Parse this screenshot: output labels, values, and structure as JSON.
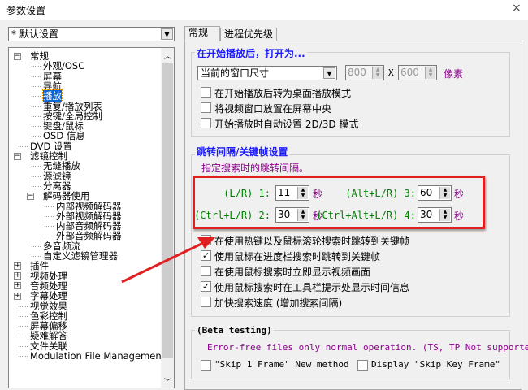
{
  "window": {
    "title": "参数设置",
    "close": "×"
  },
  "profile": {
    "value": "* 默认设置"
  },
  "tree": [
    {
      "label": "常规",
      "level": 0,
      "exp": "−"
    },
    {
      "label": "外观/OSC",
      "level": 1
    },
    {
      "label": "屏幕",
      "level": 1
    },
    {
      "label": "导航",
      "level": 1
    },
    {
      "label": "播放",
      "level": 1,
      "selected": true
    },
    {
      "label": "重复/播放列表",
      "level": 1
    },
    {
      "label": "按键/全局控制",
      "level": 1
    },
    {
      "label": "键盘/鼠标",
      "level": 1
    },
    {
      "label": "OSD 信息",
      "level": 1
    },
    {
      "label": "DVD 设置",
      "level": 0
    },
    {
      "label": "滤镜控制",
      "level": 0,
      "exp": "−"
    },
    {
      "label": "无缝播放",
      "level": 1
    },
    {
      "label": "源滤镜",
      "level": 1
    },
    {
      "label": "分离器",
      "level": 1
    },
    {
      "label": "解码器使用",
      "level": 1,
      "exp": "−"
    },
    {
      "label": "内部视频解码器",
      "level": 2
    },
    {
      "label": "外部视频解码器",
      "level": 2
    },
    {
      "label": "内部音频解码器",
      "level": 2
    },
    {
      "label": "外部音频解码器",
      "level": 2
    },
    {
      "label": "多音频流",
      "level": 1
    },
    {
      "label": "自定义滤镜管理器",
      "level": 1
    },
    {
      "label": "插件",
      "level": 0,
      "exp": "+"
    },
    {
      "label": "视频处理",
      "level": 0,
      "exp": "+"
    },
    {
      "label": "音频处理",
      "level": 0,
      "exp": "+"
    },
    {
      "label": "字幕处理",
      "level": 0,
      "exp": "+"
    },
    {
      "label": "视觉效果",
      "level": 0
    },
    {
      "label": "色彩控制",
      "level": 0
    },
    {
      "label": "屏幕偏移",
      "level": 0
    },
    {
      "label": "疑难解答",
      "level": 0
    },
    {
      "label": "文件关联",
      "level": 0
    },
    {
      "label": "Modulation File Management",
      "level": 0
    }
  ],
  "tabs": [
    {
      "label": "常规"
    },
    {
      "label": "进程优先级"
    }
  ],
  "open": {
    "title": "在开始播放后，打开为...",
    "size_mode": "当前的窗口尺寸",
    "width": "800",
    "x": "X",
    "height": "600",
    "unit": "像素",
    "checks": [
      {
        "label": "在开始播放后转为桌面播放模式",
        "checked": false
      },
      {
        "label": "将视频窗口放置在屏幕中央",
        "checked": false
      },
      {
        "label": "开始播放时自动设置 2D/3D 模式",
        "checked": false
      }
    ]
  },
  "jump": {
    "title": "跳转间隔/关键帧设置",
    "hint": "指定搜索时的跳转间隔。",
    "intervals": [
      {
        "label": "(L/R) 1:",
        "value": "11",
        "unit": "秒"
      },
      {
        "label": "(Alt+L/R) 3:",
        "value": "60",
        "unit": "秒"
      },
      {
        "label": "(Ctrl+L/R) 2:",
        "value": "30",
        "unit": "秒"
      },
      {
        "label": "(Ctrl+Alt+L/R) 4:",
        "value": "30",
        "unit": "秒"
      }
    ],
    "checks": [
      {
        "label": "在使用热键以及鼠标滚轮搜索时跳转到关键帧",
        "checked": true
      },
      {
        "label": "使用鼠标在进度栏搜索时跳转到关键帧",
        "checked": true
      },
      {
        "label": "在使用鼠标搜索时立即显示视频画面",
        "checked": false
      },
      {
        "label": "使用鼠标搜索时在工具栏提示处显示时间信息",
        "checked": true
      },
      {
        "label": "加快搜索速度 (增加搜索间隔)",
        "checked": false
      }
    ]
  },
  "beta": {
    "title": "(Beta testing)",
    "note": "Error-free files only normal operation. (TS, TP Not supported)",
    "checks": [
      {
        "label": "\"Skip 1 Frame\" New method",
        "checked": false
      },
      {
        "label": "Display \"Skip Key Frame\"",
        "checked": false
      }
    ]
  },
  "colors": {
    "annotation": "#e02020",
    "blue": "#1a1aff",
    "purple": "#8b008b",
    "green": "#008000"
  }
}
